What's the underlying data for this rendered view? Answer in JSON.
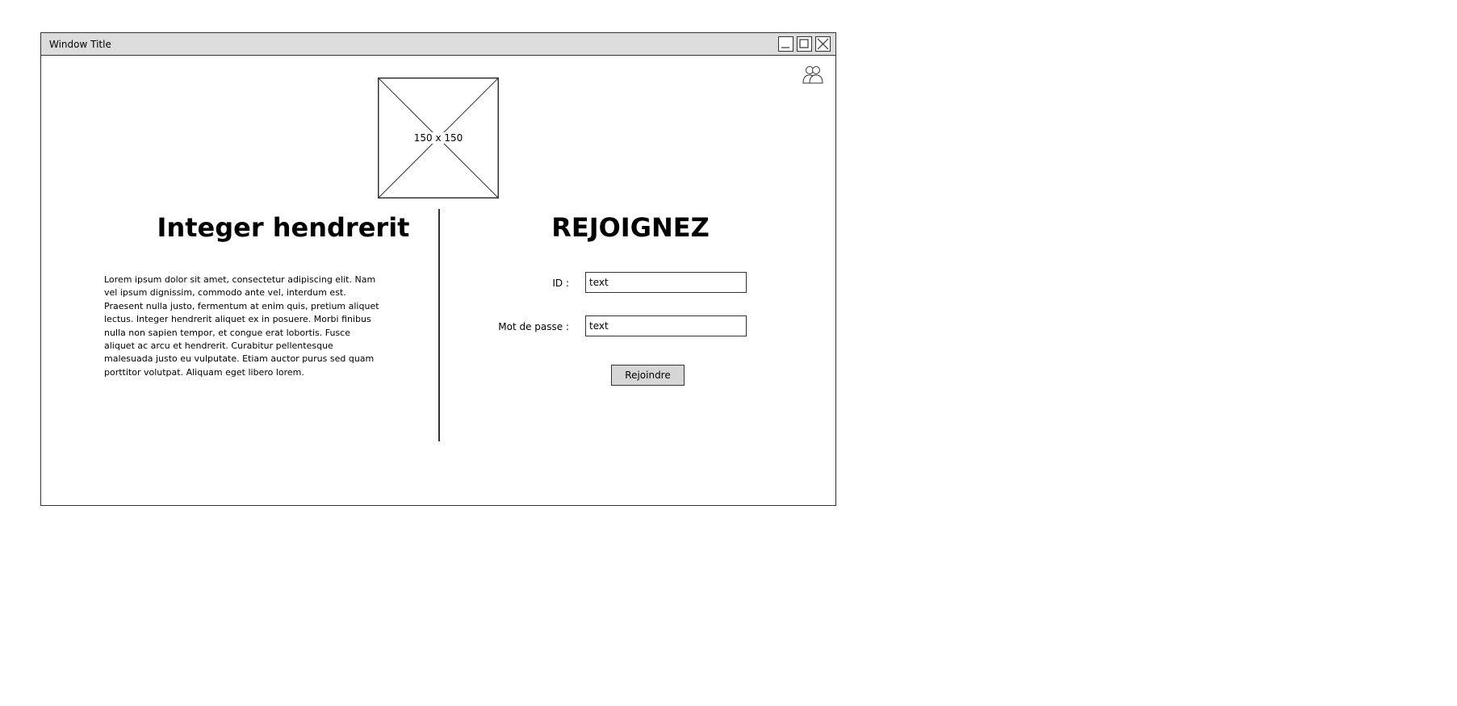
{
  "window": {
    "title": "Window Title",
    "controls": {
      "minimize": "minimize-icon",
      "maximize": "maximize-icon",
      "close": "close-icon"
    }
  },
  "header": {
    "icon": "users-icon"
  },
  "image_placeholder": {
    "icon": "image-placeholder-icon",
    "caption": "150 x 150"
  },
  "left_panel": {
    "heading": "Integer hendrerit",
    "body": "Lorem ipsum dolor sit amet, consectetur adipiscing elit. Nam vel ipsum dignissim, commodo ante vel, interdum est. Praesent nulla justo, fermentum at enim quis, pretium aliquet lectus.  Integer hendrerit aliquet ex in posuere. Morbi finibus nulla non sapien tempor, et congue erat lobortis. Fusce aliquet ac arcu et hendrerit. Curabitur pellentesque malesuada justo eu vulputate. Etiam auctor purus sed quam porttitor volutpat. Aliquam eget libero lorem."
  },
  "right_panel": {
    "heading": "REJOIGNEZ",
    "id_label": "ID :",
    "id_value": "text",
    "password_label": "Mot de passe :",
    "password_value": "text",
    "submit_label": "Rejoindre"
  }
}
